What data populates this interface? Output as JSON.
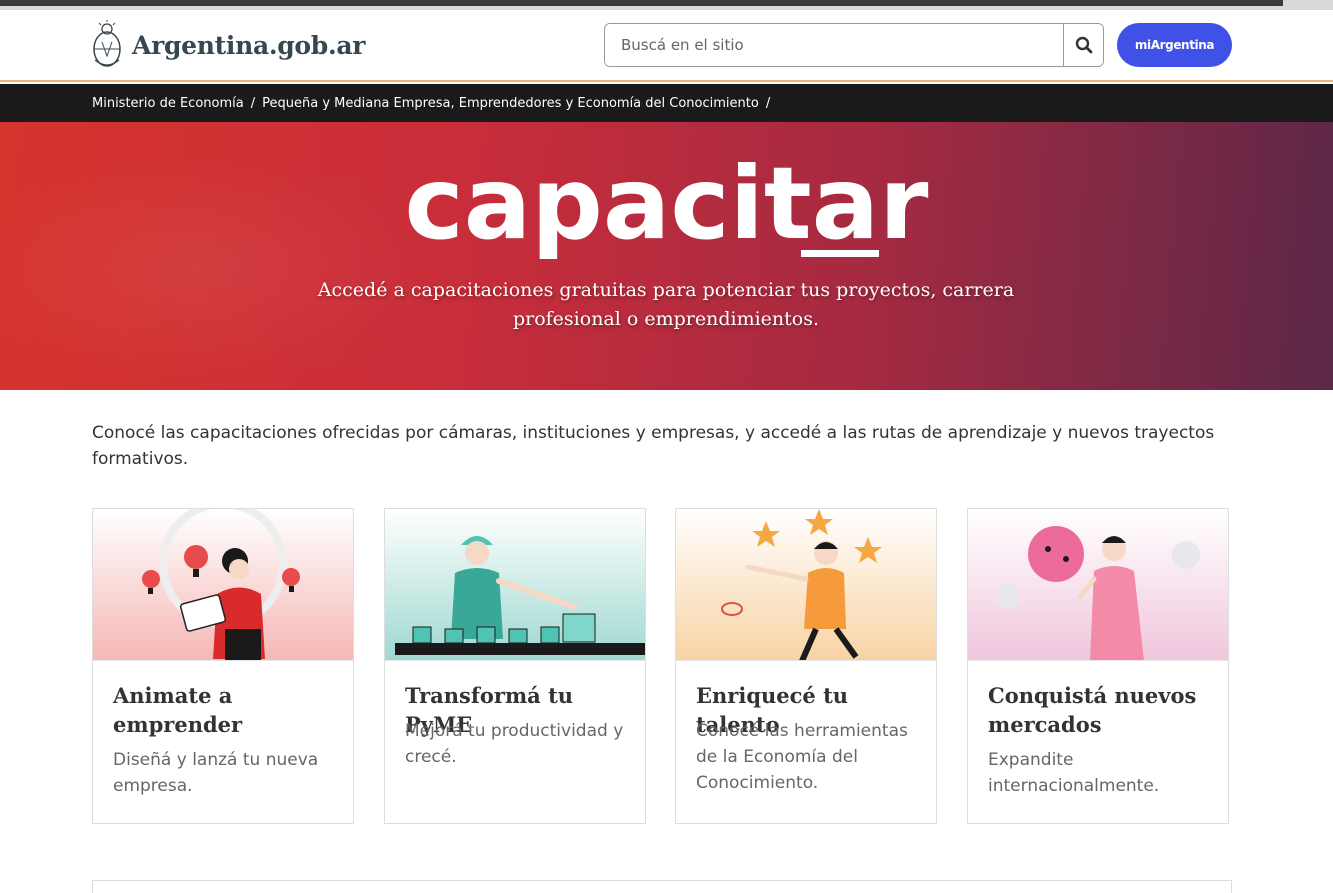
{
  "header": {
    "logo_text": "Argentina.gob.ar",
    "search_placeholder": "Buscá en el sitio",
    "mi_argentina_label": "miArgentina"
  },
  "breadcrumb": [
    {
      "label": "Ministerio de Economía"
    },
    {
      "label": "Pequeña y Mediana Empresa, Emprendedores y Economía del Conocimiento"
    }
  ],
  "hero": {
    "title": "capacitar",
    "subtitle": "Accedé a capacitaciones gratuitas para potenciar tus proyectos, carrera profesional o emprendimientos."
  },
  "intro": "Conocé las capacitaciones ofrecidas por cámaras, instituciones y empresas, y accedé a las rutas de aprendizaje y nuevos trayectos formativos.",
  "cards": [
    {
      "title": "Animate a emprender",
      "description": "Diseñá y lanzá tu nueva empresa."
    },
    {
      "title": "Transformá tu PyME",
      "description": "Mejorá tu productividad y crecé."
    },
    {
      "title": "Enriquecé tu talento",
      "description": "Conocé las herramientas de la Economía del Conocimiento."
    },
    {
      "title": "Conquistá nuevos mercados",
      "description": "Expandite internacionalmente."
    }
  ],
  "colors": {
    "accent_button": "#3f51e6",
    "hero_start": "#d6342d",
    "hero_end": "#5c2848",
    "breadcrumb_bg": "#1a1a1a"
  }
}
